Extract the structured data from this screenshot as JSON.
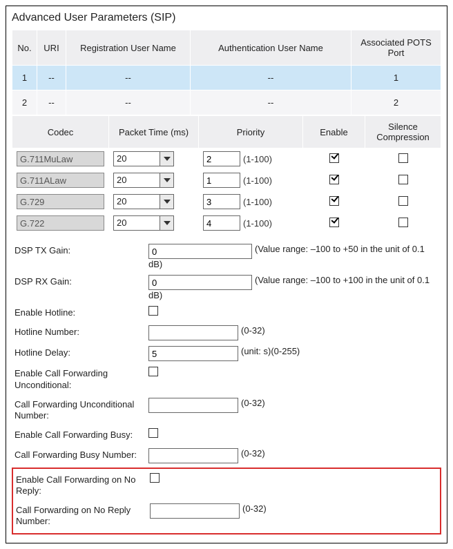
{
  "title": "Advanced User Parameters (SIP)",
  "users_table": {
    "headers": [
      "No.",
      "URI",
      "Registration User Name",
      "Authentication User Name",
      "Associated POTS Port"
    ],
    "rows": [
      {
        "no": "1",
        "uri": "--",
        "reg": "--",
        "auth": "--",
        "port": "1"
      },
      {
        "no": "2",
        "uri": "--",
        "reg": "--",
        "auth": "--",
        "port": "2"
      }
    ]
  },
  "codec_table": {
    "headers": [
      "Codec",
      "Packet Time (ms)",
      "Priority",
      "Enable",
      "Silence Compression"
    ],
    "priority_hint": "(1-100)",
    "rows": [
      {
        "codec": "G.711MuLaw",
        "ptime": "20",
        "priority": "2",
        "enable": true,
        "silence": false
      },
      {
        "codec": "G.711ALaw",
        "ptime": "20",
        "priority": "1",
        "enable": true,
        "silence": false
      },
      {
        "codec": "G.729",
        "ptime": "20",
        "priority": "3",
        "enable": true,
        "silence": false
      },
      {
        "codec": "G.722",
        "ptime": "20",
        "priority": "4",
        "enable": true,
        "silence": false
      }
    ]
  },
  "form": {
    "dsp_tx": {
      "label": "DSP TX Gain:",
      "value": "0",
      "unit": "dB)",
      "hint": "(Value range: –100 to +50 in the unit of 0.1"
    },
    "dsp_rx": {
      "label": "DSP RX Gain:",
      "value": "0",
      "unit": "dB)",
      "hint": "(Value range: –100 to +100 in the unit of 0.1"
    },
    "enable_hotline": {
      "label": "Enable Hotline:",
      "checked": false
    },
    "hotline_number": {
      "label": "Hotline Number:",
      "value": "",
      "hint": "(0-32)"
    },
    "hotline_delay": {
      "label": "Hotline Delay:",
      "value": "5",
      "hint": "(unit: s)(0-255)"
    },
    "cfu_enable": {
      "label": "Enable Call Forwarding Unconditional:",
      "checked": false
    },
    "cfu_number": {
      "label": "Call Forwarding Unconditional Number:",
      "value": "",
      "hint": "(0-32)"
    },
    "cfb_enable": {
      "label": "Enable Call Forwarding Busy:",
      "checked": false
    },
    "cfb_number": {
      "label": "Call Forwarding Busy Number:",
      "value": "",
      "hint": "(0-32)"
    },
    "cfnr_enable": {
      "label": "Enable Call Forwarding on No Reply:",
      "checked": false
    },
    "cfnr_number": {
      "label": "Call Forwarding on No Reply Number:",
      "value": "",
      "hint": "(0-32)"
    }
  }
}
